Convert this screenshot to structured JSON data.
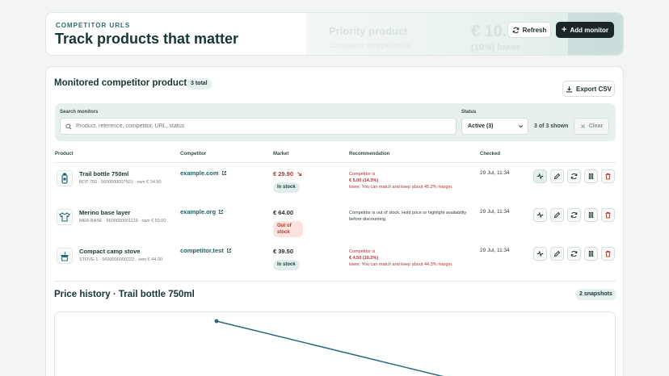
{
  "header": {
    "eyebrow": "COMPETITOR URLS",
    "title": "Track products that matter",
    "deco": {
      "line1": "Priority product",
      "line2": "Competitor dropped price",
      "price": "€ 10.00",
      "pct": "(10%) lower"
    },
    "refresh_label": "Refresh",
    "add_label": "Add monitor"
  },
  "monitored": {
    "title": "Monitored competitor products",
    "total_badge": "3 total",
    "export_label": "Export CSV",
    "search_label": "Search monitors",
    "search_placeholder": "Product, reference, competitor, URL, status",
    "status_label": "Status",
    "status_value": "Active (3)",
    "shown": "3 of 3 shown",
    "clear_label": "Clear",
    "columns": {
      "product": "Product",
      "competitor": "Competitor",
      "market": "Market",
      "recommendation": "Recommendation",
      "checked": "Checked"
    }
  },
  "rows": [
    {
      "name": "Trail bottle 750ml",
      "meta": "BOT-750 · 5600000007501 · own € 34.90",
      "competitor": "example.com",
      "price": "€ 29.90",
      "stock": "In stock",
      "rec_line1": "Competitor is",
      "rec_bold": "€ 5.00 (14.3%)",
      "rec_line3": "lower. You can match and keep about 45.2% margin.",
      "checked": "29 Jul, 11:34"
    },
    {
      "name": "Merino base layer",
      "meta": "MER-BASE · 5600000001119 · own € 59.00",
      "competitor": "example.org",
      "price": "€ 64.00",
      "stock": "Out of stock",
      "rec_text": "Competitor is out of stock. Hold price or highlight availability before discounting.",
      "checked": "29 Jul, 11:34"
    },
    {
      "name": "Compact camp stove",
      "meta": "STOVE-1 · 5600000000222 · own € 44.00",
      "competitor": "competitor.test",
      "price": "€ 39.50",
      "stock": "In stock",
      "rec_line1": "Competitor is",
      "rec_bold": "€ 4.50 (10.2%)",
      "rec_line3": "lower. You can match and keep about 44.3% margin.",
      "checked": "29 Jul, 11:34"
    }
  ],
  "history": {
    "title": "Price history · Trail bottle 750ml",
    "snapshots_badge": "2 snapshots"
  },
  "colors": {
    "accent": "#1f5e63",
    "danger": "#b5322a",
    "dark_button": "#1b2626",
    "line": "#2a6a74"
  }
}
